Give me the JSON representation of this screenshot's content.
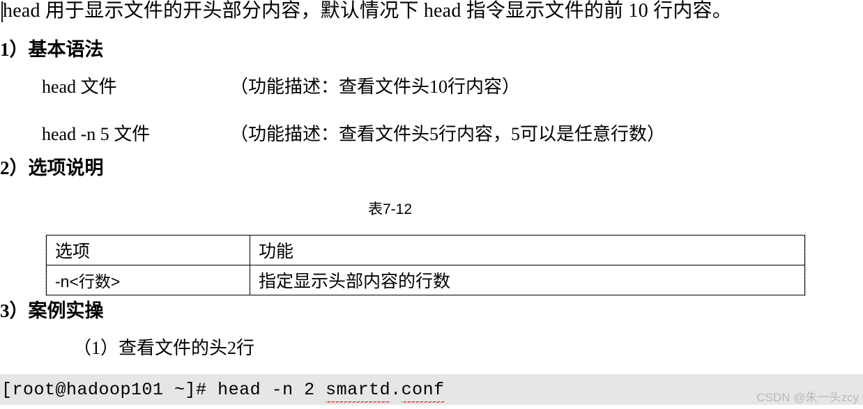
{
  "document": {
    "intro": "head 用于显示文件的开头部分内容，默认情况下 head 指令显示文件的前 10 行内容。",
    "sections": [
      {
        "heading": "1）基本语法",
        "syntax": [
          {
            "command": "head  文件",
            "description": "（功能描述：查看文件头10行内容）"
          },
          {
            "command": "head -n 5  文件",
            "description": "（功能描述：查看文件头5行内容，5可以是任意行数）"
          }
        ]
      },
      {
        "heading": "2）选项说明",
        "table_caption": "表7-12",
        "table": {
          "headers": [
            "选项",
            "功能"
          ],
          "rows": [
            [
              "-n<行数>",
              "指定显示头部内容的行数"
            ]
          ]
        }
      },
      {
        "heading": "3）案例实操",
        "example_label": "（1）查看文件的头2行"
      }
    ]
  },
  "terminal": {
    "prompt": "[root@hadoop101 ~]# ",
    "command": "head -n 2 ",
    "argument_misspelled_1": "smartd",
    "separator": ".",
    "argument_misspelled_2": "conf",
    "background_color": "#e6e6e6",
    "spellcheck_underline_color": "#d01c1c"
  },
  "watermark": {
    "text": "CSDN @朱一头zcy",
    "color": "#b9b9b9"
  }
}
